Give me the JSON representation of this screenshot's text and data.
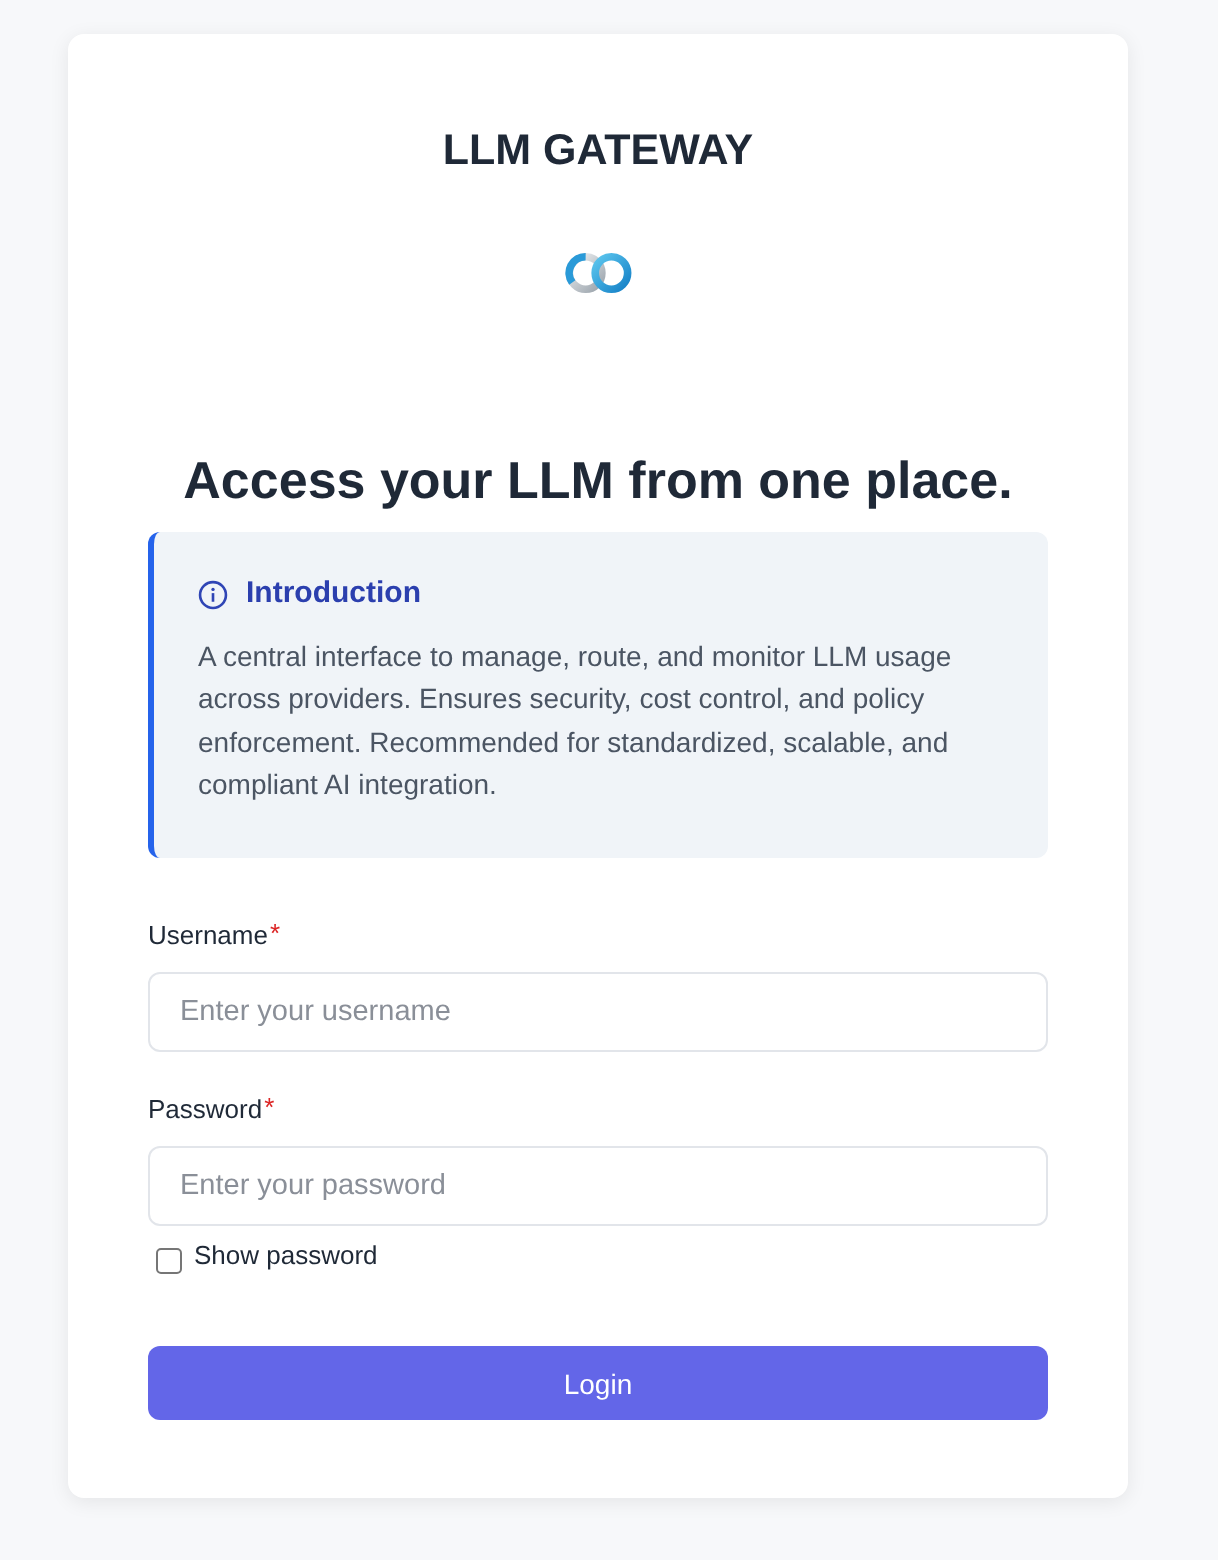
{
  "app_title": "LLM GATEWAY",
  "headline": "Access your LLM from one place.",
  "intro": {
    "title": "Introduction",
    "body": "A central interface to manage, route, and monitor LLM usage across providers. Ensures security, cost control, and policy enforcement. Recommended for standardized, scalable, and compliant AI integration."
  },
  "fields": [
    {
      "label": "Username",
      "required_mark": "*",
      "placeholder": "Enter your username"
    },
    {
      "label": "Password",
      "required_mark": "*",
      "placeholder": "Enter your password"
    }
  ],
  "show_password": {
    "label": "Show password",
    "checked": false
  },
  "login_button": "Login"
}
